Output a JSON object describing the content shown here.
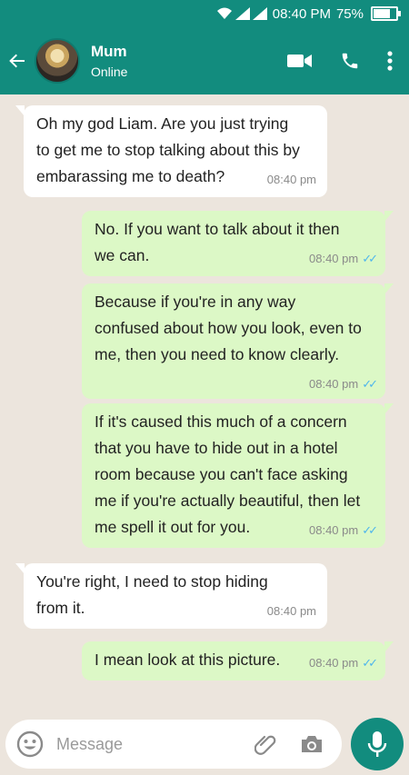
{
  "status_bar": {
    "time": "08:40 PM",
    "battery": "75%",
    "battery_level": 0.75
  },
  "header": {
    "name": "Mum",
    "status": "Online"
  },
  "messages": [
    {
      "dir": "in",
      "text": "Oh my god Liam. Are you just trying\nto get me to stop talking about this by\nembarassing me to death?",
      "time": "08:40 pm"
    },
    {
      "dir": "out",
      "text": "No. If you want to talk about it then\nwe can.",
      "time": "08:40 pm"
    },
    {
      "dir": "out",
      "text": "Because if you're in any way\nconfused about how you look, even to\nme, then you need to know clearly.",
      "time": "08:40 pm"
    },
    {
      "dir": "out",
      "text": "If it's caused this much of a concern\nthat you have to hide out in a hotel\nroom because you can't face asking\nme if you're actually beautiful, then let\nme spell it out for you.",
      "time": "08:40 pm"
    },
    {
      "dir": "in",
      "text": "You're right, I need to stop hiding\nfrom it.",
      "time": "08:40 pm"
    },
    {
      "dir": "out",
      "text": "I mean look at this picture.",
      "time": "08:40 pm"
    }
  ],
  "composer": {
    "placeholder": "Message"
  },
  "icons": {
    "back": "arrow-left-icon",
    "video": "video-call-icon",
    "call": "phone-icon",
    "menu": "more-vert-icon",
    "emoji": "emoji-icon",
    "attach": "paperclip-icon",
    "camera": "camera-icon",
    "mic": "mic-icon"
  },
  "colors": {
    "primary": "#128c7e",
    "outgoing": "#dcf8c6",
    "incoming": "#ffffff",
    "read_ticks": "#4fb6ec",
    "wallpaper": "#ece5dd"
  }
}
